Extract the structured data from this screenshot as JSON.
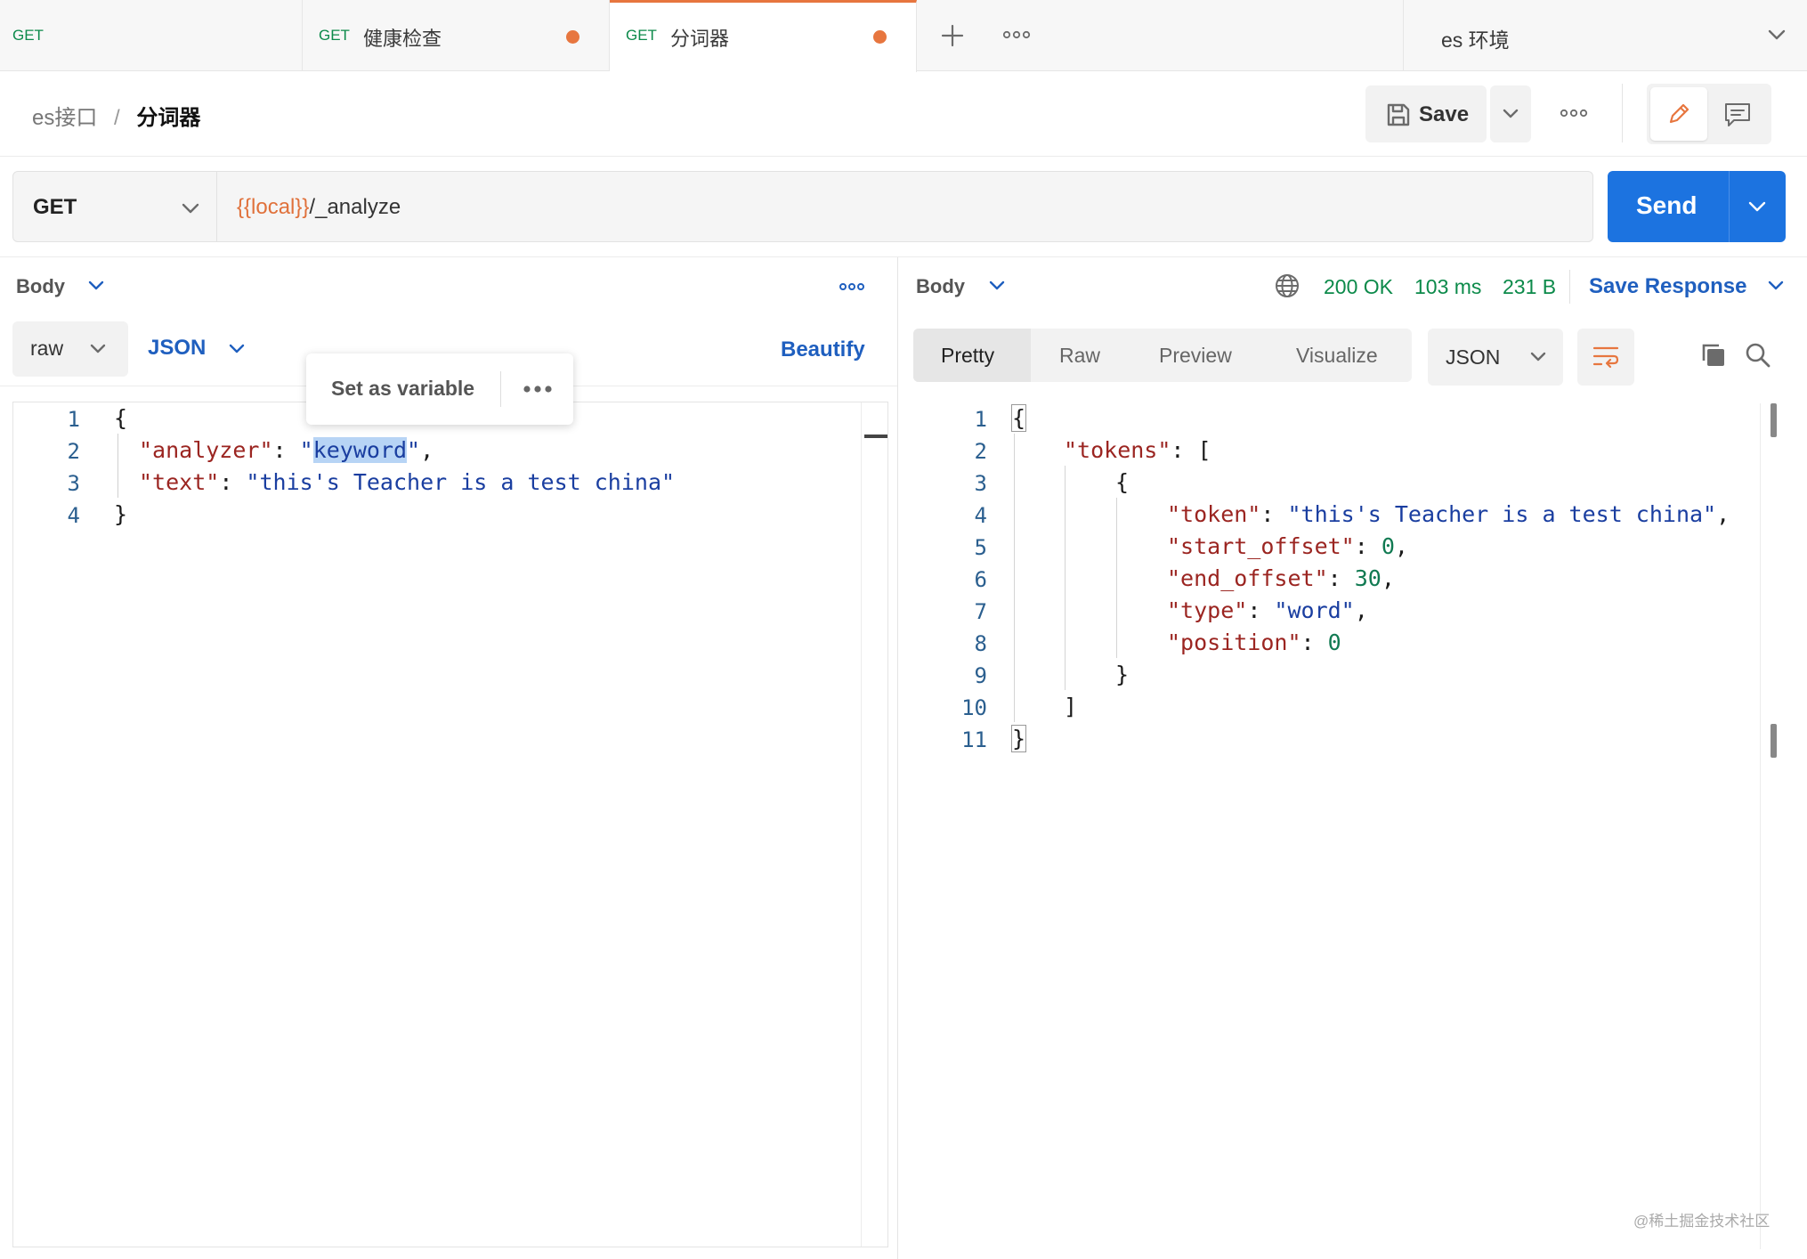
{
  "tabs": [
    {
      "method": "GET",
      "title": ""
    },
    {
      "method": "GET",
      "title": "健康检查"
    },
    {
      "method": "GET",
      "title": "分词器"
    }
  ],
  "environment": {
    "label": "es 环境"
  },
  "breadcrumb": {
    "collection": "es接口",
    "separator": "/",
    "request": "分词器"
  },
  "header": {
    "save_label": "Save"
  },
  "request": {
    "method": "GET",
    "url_variable": "{{local}}",
    "url_path": "/_analyze",
    "send_label": "Send"
  },
  "request_body": {
    "section_label": "Body",
    "mode": "raw",
    "format": "JSON",
    "beautify_label": "Beautify",
    "tooltip": {
      "set_as_variable": "Set as variable"
    },
    "line_numbers": [
      "1",
      "2",
      "3",
      "4"
    ],
    "code": {
      "open": "{",
      "analyzer_key": "\"analyzer\"",
      "analyzer_quote_open": "\"",
      "analyzer_value": "keyword",
      "analyzer_quote_close": "\"",
      "text_key": "\"text\"",
      "text_value": "\"this's Teacher is a test china\"",
      "close": "}"
    }
  },
  "response": {
    "section_label": "Body",
    "status": "200 OK",
    "time": "103 ms",
    "size": "231 B",
    "save_response_label": "Save Response",
    "view_tabs": [
      "Pretty",
      "Raw",
      "Preview",
      "Visualize"
    ],
    "active_view": "Pretty",
    "format": "JSON",
    "line_numbers": [
      "1",
      "2",
      "3",
      "4",
      "5",
      "6",
      "7",
      "8",
      "9",
      "10",
      "11"
    ],
    "code": {
      "open": "{",
      "tokens_key": "\"tokens\"",
      "array_open": "[",
      "obj_open": "{",
      "token_key": "\"token\"",
      "token_value": "\"this's Teacher is a test china\"",
      "start_offset_key": "\"start_offset\"",
      "start_offset_value": "0",
      "end_offset_key": "\"end_offset\"",
      "end_offset_value": "30",
      "type_key": "\"type\"",
      "type_value": "\"word\"",
      "position_key": "\"position\"",
      "position_value": "0",
      "obj_close": "}",
      "array_close": "]",
      "close": "}"
    }
  },
  "watermark": "@稀土掘金技术社区",
  "colors": {
    "accent": "#e7763f",
    "send": "#1c73e0",
    "link": "#1f5fbf",
    "status_ok": "#0c8a4a"
  }
}
